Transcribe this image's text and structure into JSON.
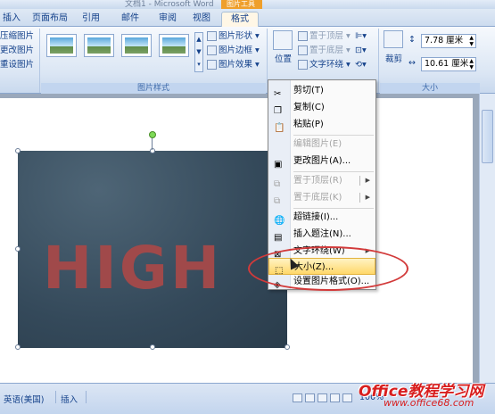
{
  "window": {
    "title": "文档1 - Microsoft Word",
    "context_tab_group": "图片工具"
  },
  "tabs": [
    "插入",
    "页面布局",
    "引用",
    "邮件",
    "审阅",
    "视图",
    "格式"
  ],
  "ribbon": {
    "adjust_group": [
      "压缩图片",
      "更改图片",
      "重设图片"
    ],
    "picture_styles_label": "图片样式",
    "picture_options": [
      "图片形状",
      "图片边框",
      "图片效果"
    ],
    "arrange": {
      "position_label": "位置",
      "bring_front": "置于顶层",
      "send_back": "置于底层",
      "text_wrap": "文字环绕"
    },
    "crop_label": "裁剪",
    "size_label": "大小",
    "height_value": "7.78 厘米",
    "width_value": "10.61 厘米"
  },
  "document": {
    "image_text": "HIGH"
  },
  "context_menu": [
    {
      "label": "剪切(T)",
      "enabled": true,
      "icon": "scissors-icon"
    },
    {
      "label": "复制(C)",
      "enabled": true,
      "icon": "copy-icon"
    },
    {
      "label": "粘贴(P)",
      "enabled": true,
      "icon": "paste-icon"
    },
    {
      "label": "编辑图片(E)",
      "enabled": false,
      "icon": ""
    },
    {
      "label": "更改图片(A)...",
      "enabled": true,
      "icon": "change-picture-icon"
    },
    {
      "label": "置于顶层(R)",
      "enabled": false,
      "icon": "bring-front-icon",
      "submenu": true
    },
    {
      "label": "置于底层(K)",
      "enabled": false,
      "icon": "send-back-icon",
      "submenu": true
    },
    {
      "label": "超链接(I)...",
      "enabled": true,
      "icon": "hyperlink-icon"
    },
    {
      "label": "插入题注(N)...",
      "enabled": true,
      "icon": "caption-icon"
    },
    {
      "label": "文字环绕(W)",
      "enabled": true,
      "icon": "wrap-icon",
      "submenu": true
    },
    {
      "label": "大小(Z)...",
      "enabled": true,
      "icon": "size-icon",
      "highlighted": true
    },
    {
      "label": "设置图片格式(O)...",
      "enabled": true,
      "icon": "format-picture-icon"
    }
  ],
  "statusbar": {
    "language": "英语(美国)",
    "mode": "插入",
    "zoom": "100%"
  },
  "watermark": {
    "brand": "Office教程学习网",
    "url": "www.office68.com"
  },
  "colors": {
    "highlight": "#ffd86a",
    "annotation_oval": "#d23a3a",
    "image_text": "#a0494a",
    "watermark": "#d81e1e"
  }
}
